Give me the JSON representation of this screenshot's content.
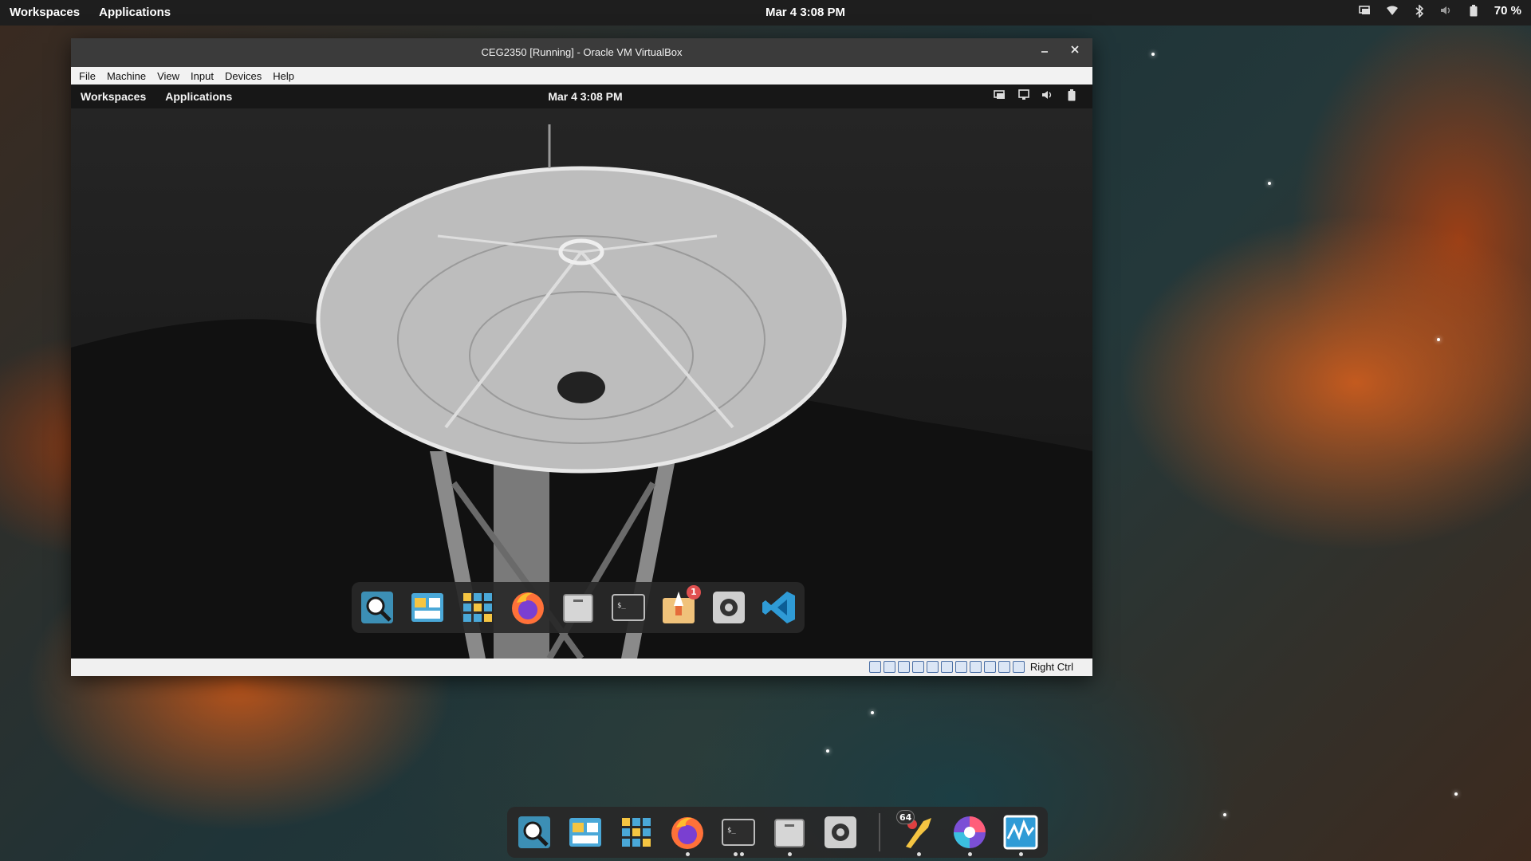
{
  "host_topbar": {
    "workspaces": "Workspaces",
    "applications": "Applications",
    "datetime": "Mar 4   3:08 PM",
    "battery": "70 %"
  },
  "vbox": {
    "title": "CEG2350 [Running] - Oracle VM VirtualBox",
    "menu": [
      "File",
      "Machine",
      "View",
      "Input",
      "Devices",
      "Help"
    ],
    "host_key": "Right Ctrl"
  },
  "guest_topbar": {
    "workspaces": "Workspaces",
    "applications": "Applications",
    "datetime": "Mar 4   3:08 PM"
  },
  "guest_dock": {
    "items": [
      "search-app",
      "workspace-switcher",
      "app-grid",
      "firefox",
      "files",
      "terminal",
      "installer",
      "settings",
      "vscode"
    ],
    "installer_badge": "1"
  },
  "host_dock": {
    "items": [
      "search-app",
      "workspace-switcher",
      "app-grid",
      "firefox",
      "terminal",
      "files",
      "settings",
      "ghidra",
      "color-picker",
      "system-monitor"
    ],
    "ghidra_badge": "64"
  },
  "colors": {
    "topbar": "#1e1e1e",
    "dock_bg": "#282828",
    "accent_blue": "#2f9bd6"
  }
}
